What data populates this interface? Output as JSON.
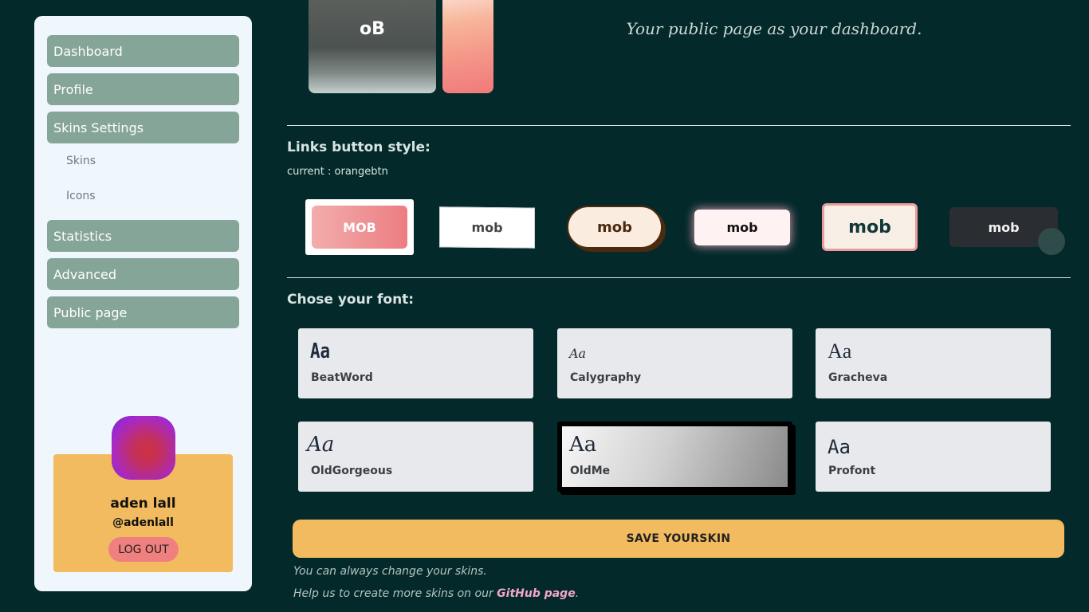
{
  "sidebar": {
    "items": [
      {
        "label": "Dashboard"
      },
      {
        "label": "Profile"
      },
      {
        "label": "Skins Settings"
      },
      {
        "label": "Statistics"
      },
      {
        "label": "Advanced"
      },
      {
        "label": "Public page"
      }
    ],
    "sub_items": [
      {
        "label": "Skins"
      },
      {
        "label": "Icons"
      }
    ],
    "user": {
      "name": "aden lall",
      "handle": "@adenlall",
      "logout_label": "LOG OUT"
    }
  },
  "preview": {
    "skin_label": "oB",
    "tagline": "Your public page as your dashboard."
  },
  "button_style": {
    "title": "Links button style:",
    "current": "current : orangebtn",
    "options": [
      {
        "label": "MOB"
      },
      {
        "label": "mob"
      },
      {
        "label": "mob"
      },
      {
        "label": "mob"
      },
      {
        "label": "mob"
      },
      {
        "label": "mob"
      }
    ]
  },
  "fonts": {
    "title": "Chose your font:",
    "options": [
      {
        "sample": "Aa",
        "name": "BeatWord"
      },
      {
        "sample": "Aa",
        "name": "Calygraphy"
      },
      {
        "sample": "Aa",
        "name": "Gracheva"
      },
      {
        "sample": "Aa",
        "name": "OldGorgeous"
      },
      {
        "sample": "Aa",
        "name": "OldMe",
        "selected": true
      },
      {
        "sample": "Aa",
        "name": "Profont"
      }
    ]
  },
  "footer": {
    "save_label": "SAVE YOURSKIN",
    "note1": "You can always change your skins.",
    "note2_prefix": "Help us to create more skins on our ",
    "note2_link": "GitHub page",
    "note2_suffix": "."
  },
  "colors": {
    "background": "#04292a",
    "accent": "#f3bb5f",
    "nav": "#86a599",
    "logout": "#f08080"
  }
}
